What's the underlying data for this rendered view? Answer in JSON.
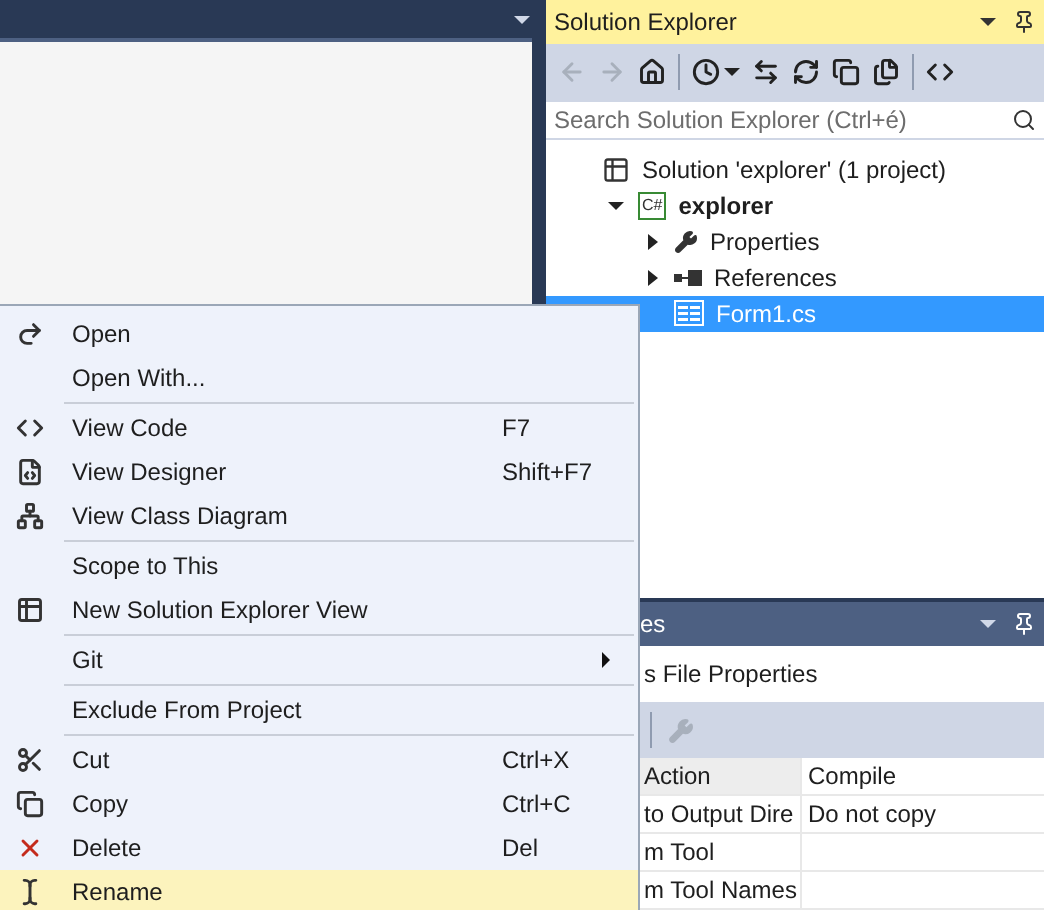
{
  "solution_explorer": {
    "title": "Solution Explorer",
    "toolbar": [
      {
        "kind": "back",
        "disabled": true
      },
      {
        "kind": "forward",
        "disabled": true
      },
      {
        "kind": "home",
        "disabled": false
      },
      {
        "kind": "history",
        "disabled": false
      },
      {
        "kind": "sync",
        "disabled": false
      },
      {
        "kind": "refresh",
        "disabled": false
      },
      {
        "kind": "collapse",
        "disabled": false
      },
      {
        "kind": "show-all",
        "disabled": false
      },
      {
        "kind": "code",
        "disabled": false
      }
    ],
    "search": {
      "placeholder": "Search Solution Explorer (Ctrl+é)"
    },
    "tree": [
      {
        "label": "Solution 'explorer' (1 project)",
        "kind": "solution",
        "bold": false,
        "selected": false,
        "children": [
          {
            "label": "explorer",
            "kind": "project",
            "badge": "C#",
            "bold": true,
            "selected": false,
            "expanded": true,
            "children": [
              {
                "label": "Properties",
                "kind": "properties",
                "bold": false,
                "selected": false,
                "expanded": false
              },
              {
                "label": "References",
                "kind": "references",
                "bold": false,
                "selected": false,
                "expanded": false
              },
              {
                "label": "Form1.cs",
                "kind": "form",
                "bold": false,
                "selected": true
              }
            ]
          }
        ]
      }
    ]
  },
  "properties": {
    "title": "es",
    "subtitle": "s File Properties",
    "rows": [
      {
        "name": "Action",
        "value": "Compile"
      },
      {
        "name": "to Output Dire",
        "value": "Do not copy"
      },
      {
        "name": "m Tool"
      },
      {
        "name": "m Tool Names"
      }
    ]
  },
  "context_menu": [
    {
      "kind": "open",
      "label": "Open",
      "selected": false
    },
    {
      "kind": "plain",
      "label": "Open With...",
      "selected": false
    },
    {
      "kind": "separator"
    },
    {
      "kind": "code",
      "label": "View Code",
      "shortcut": "F7",
      "selected": false
    },
    {
      "kind": "designer",
      "label": "View Designer",
      "shortcut": "Shift+F7",
      "selected": false
    },
    {
      "kind": "diagram",
      "label": "View Class Diagram",
      "selected": false
    },
    {
      "kind": "separator"
    },
    {
      "kind": "plain",
      "label": "Scope to This",
      "selected": false
    },
    {
      "kind": "newview",
      "label": "New Solution Explorer View",
      "selected": false
    },
    {
      "kind": "separator"
    },
    {
      "kind": "plain",
      "label": "Git",
      "submenu": true,
      "selected": false
    },
    {
      "kind": "separator"
    },
    {
      "kind": "plain",
      "label": "Exclude From Project",
      "selected": false
    },
    {
      "kind": "separator"
    },
    {
      "kind": "cut",
      "label": "Cut",
      "shortcut": "Ctrl+X",
      "selected": false
    },
    {
      "kind": "copy",
      "label": "Copy",
      "shortcut": "Ctrl+C",
      "selected": false
    },
    {
      "kind": "delete",
      "label": "Delete",
      "shortcut": "Del",
      "selected": false
    },
    {
      "kind": "rename",
      "label": "Rename",
      "selected": true
    }
  ]
}
